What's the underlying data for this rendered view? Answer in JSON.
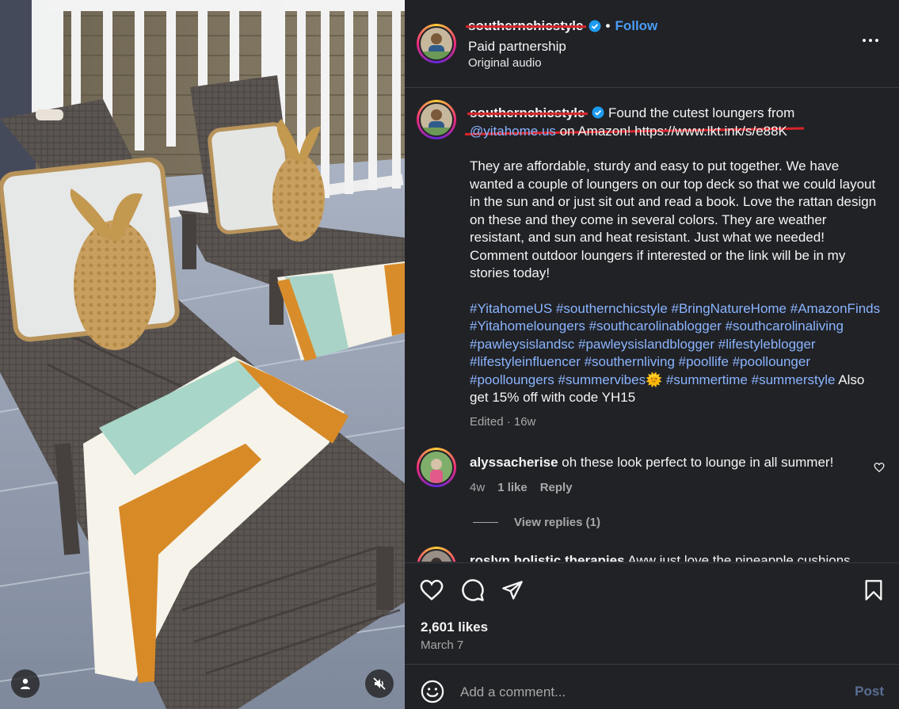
{
  "post": {
    "author": "southernchicstyle",
    "follow_label": "Follow",
    "separator": "•",
    "subtitle": "Paid partnership",
    "audio": "Original audio"
  },
  "caption": {
    "author": "southernchicstyle",
    "lead": " Found the cutest loungers from ",
    "mention": "@yitahome.us",
    "lead2": " on Amazon! https://www.lkt.ink/s/e88K",
    "body": "They are affordable, sturdy and easy to put together. We have wanted a couple of loungers on our top deck so that we could layout in the sun and or just sit out and read a book. Love the rattan design on these and they come in several colors. They are weather resistant, and sun and heat resistant. Just what we needed! Comment outdoor loungers if interested or the link will be in my stories today!",
    "hashtags": "#YitahomeUS #southernchicstyle #BringNatureHome #AmazonFinds #Yitahomeloungers #southcarolinablogger #southcarolinaliving #pawleysislandsc #pawleysislandblogger #lifestyleblogger #lifestyleinfluencer #southernliving #poollife #poollounger #poolloungers #summervibes",
    "emoji": "🌞",
    "hashtags2": " #summertime #summerstyle",
    "tail": " Also get 15% off with code YH15",
    "edited": "Edited · 16w"
  },
  "comments": [
    {
      "user": "alyssacherise",
      "text": " oh these look perfect to lounge in all summer!",
      "time": "4w",
      "likes": "1 like",
      "reply_label": "Reply",
      "view_replies": "View replies (1)"
    },
    {
      "user": "roslyn.holistic.therapies",
      "text": " Aww just love the pineapple cushions"
    }
  ],
  "footer": {
    "likes": "2,601 likes",
    "date": "March 7",
    "comment_placeholder": "Add a comment...",
    "post_label": "Post"
  },
  "icons": {
    "like": "heart-icon",
    "comment": "comment-icon",
    "share": "send-icon",
    "save": "bookmark-icon",
    "emoji": "emoji-icon",
    "more": "more-icon",
    "mute": "mute-icon",
    "tagged_user": "user-icon"
  },
  "colors": {
    "panel_bg": "#212226",
    "link": "#8ab4ff",
    "follow": "#4a9cf5",
    "muted": "#a8a8a8",
    "redaction": "#d9252b"
  }
}
